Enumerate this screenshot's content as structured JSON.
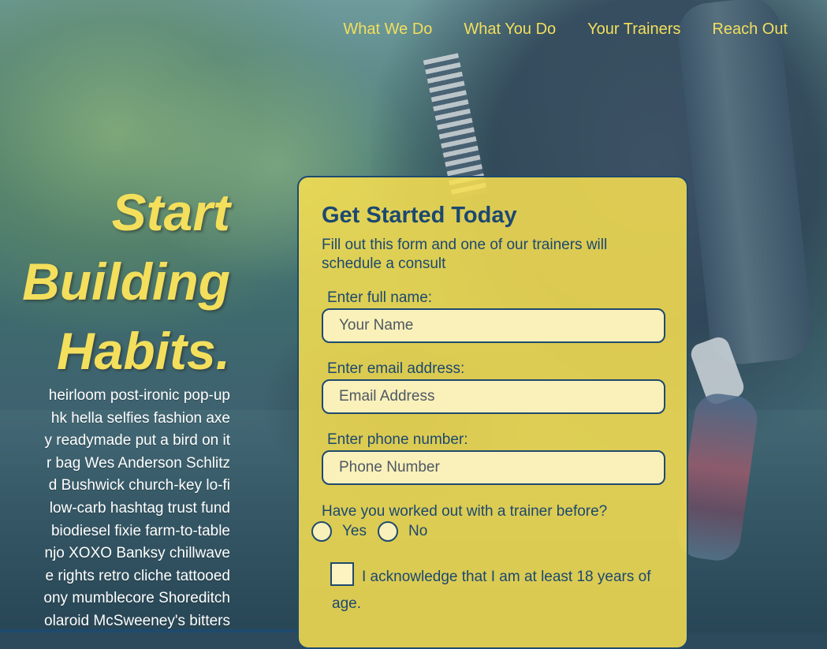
{
  "nav": {
    "items": [
      "What We Do",
      "What You Do",
      "Your Trainers",
      "Reach Out"
    ]
  },
  "hero": {
    "title_lines": [
      "Start",
      "Building",
      "Habits."
    ],
    "body_lines": [
      "heirloom post-ironic pop-up",
      "hk hella selfies fashion axe",
      "y readymade put a bird on it",
      "r bag Wes Anderson Schlitz",
      "d Bushwick church-key lo-fi",
      "low-carb hashtag trust fund",
      "biodiesel fixie farm-to-table",
      "njo XOXO Banksy chillwave",
      "e rights retro cliche tattooed",
      "ony mumblecore Shoreditch",
      "olaroid McSweeney's bitters"
    ]
  },
  "form": {
    "title": "Get Started Today",
    "subtitle": "Fill out this form and one of our trainers will schedule a consult",
    "name_label": "Enter full name:",
    "name_placeholder": "Your Name",
    "email_label": "Enter email address:",
    "email_placeholder": "Email Address",
    "phone_label": "Enter phone number:",
    "phone_placeholder": "Phone Number",
    "question": "Have you worked out with a trainer before?",
    "option_yes": "Yes",
    "option_no": "No",
    "acknowledge": "I acknowledge that I am at least 18 years of age."
  },
  "colors": {
    "accent_yellow": "#f3df5c",
    "navy": "#1c4870",
    "card_bg": "#f8e050"
  }
}
